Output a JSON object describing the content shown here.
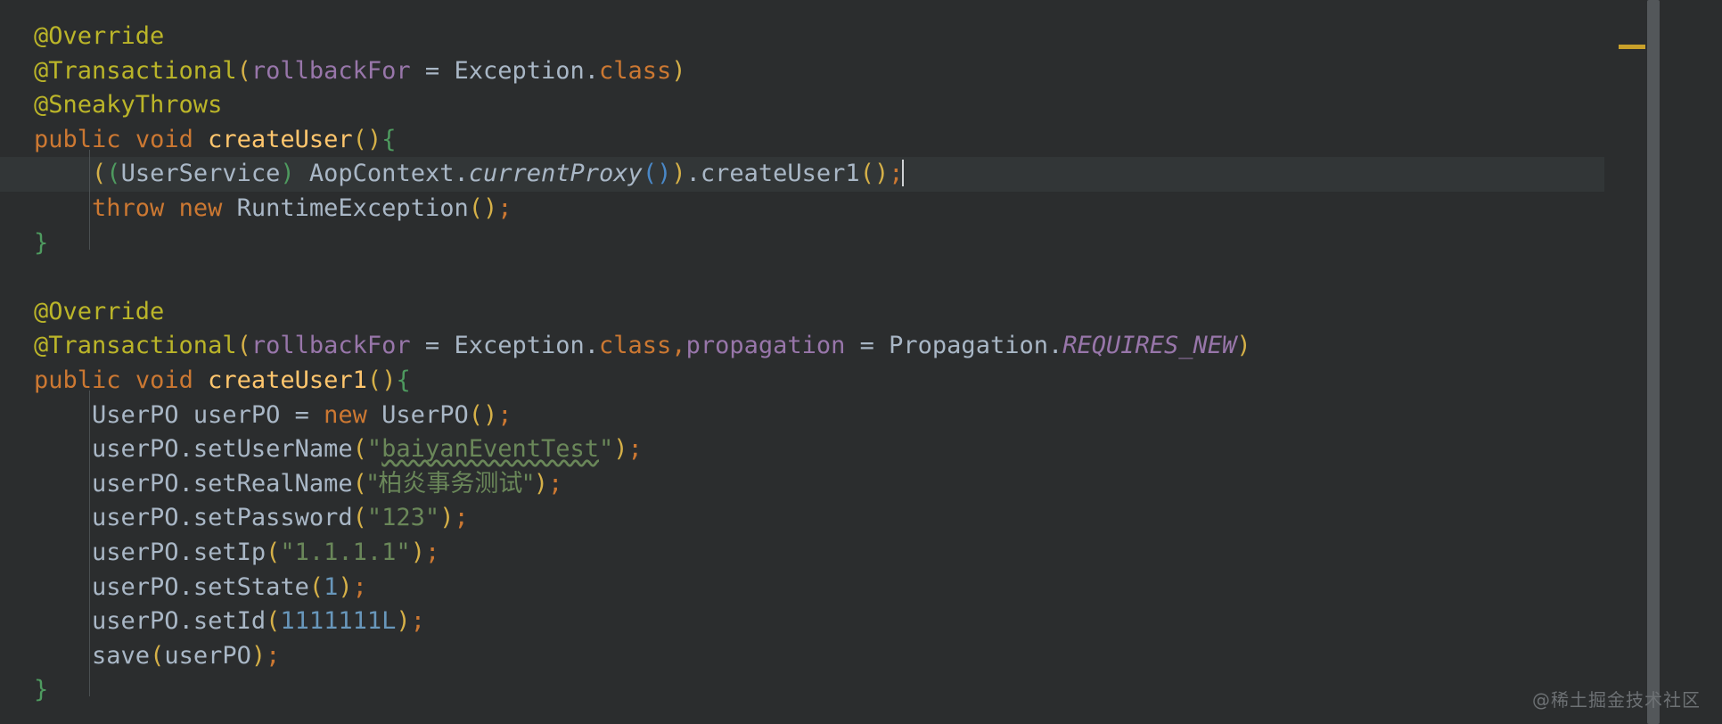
{
  "editor": {
    "theme": "darcula",
    "background_color": "#2b2d2e",
    "current_line_color": "#323637",
    "default_text_color": "#a9b7c6",
    "annotation_color": "#bbb529",
    "keyword_color": "#cc7832",
    "method_color": "#ffc66d",
    "string_color": "#6a8759",
    "number_color": "#6897bb",
    "constant_color": "#9876aa",
    "language": "Java"
  },
  "code": {
    "lines": [
      {
        "id": 1,
        "text": "@Override",
        "tokens": [
          {
            "t": "@Override",
            "c": "annot"
          }
        ]
      },
      {
        "id": 2,
        "text": "@Transactional(rollbackFor = Exception.class)",
        "tokens": [
          {
            "t": "@Transactional",
            "c": "annot"
          },
          {
            "t": "(",
            "c": "par-y"
          },
          {
            "t": "rollbackFor",
            "c": "field"
          },
          {
            "t": " = ",
            "c": "eq"
          },
          {
            "t": "Exception",
            "c": "ident"
          },
          {
            "t": ".",
            "c": "punct"
          },
          {
            "t": "class",
            "c": "kw"
          },
          {
            "t": ")",
            "c": "par-y"
          }
        ]
      },
      {
        "id": 3,
        "text": "@SneakyThrows",
        "tokens": [
          {
            "t": "@SneakyThrows",
            "c": "annot"
          }
        ]
      },
      {
        "id": 4,
        "text": "public void createUser(){",
        "tokens": [
          {
            "t": "public",
            "c": "kw"
          },
          {
            "t": " ",
            "c": "punct"
          },
          {
            "t": "void",
            "c": "kw"
          },
          {
            "t": " ",
            "c": "punct"
          },
          {
            "t": "createUser",
            "c": "method"
          },
          {
            "t": "(",
            "c": "par-y"
          },
          {
            "t": ")",
            "c": "par-y"
          },
          {
            "t": "{",
            "c": "par-g"
          }
        ]
      },
      {
        "id": 5,
        "current": true,
        "caret_at_end": true,
        "text": "    ((UserService) AopContext.currentProxy()).createUser1();",
        "tokens": [
          {
            "t": "    ",
            "c": "punct"
          },
          {
            "t": "(",
            "c": "par-y"
          },
          {
            "t": "(",
            "c": "par-g"
          },
          {
            "t": "UserService",
            "c": "ident"
          },
          {
            "t": ")",
            "c": "par-g"
          },
          {
            "t": " ",
            "c": "punct"
          },
          {
            "t": "AopContext",
            "c": "ident"
          },
          {
            "t": ".",
            "c": "punct"
          },
          {
            "t": "currentProxy",
            "c": "static-i"
          },
          {
            "t": "(",
            "c": "par-b"
          },
          {
            "t": ")",
            "c": "par-b"
          },
          {
            "t": ")",
            "c": "par-y"
          },
          {
            "t": ".",
            "c": "punct"
          },
          {
            "t": "createUser1",
            "c": "ident"
          },
          {
            "t": "(",
            "c": "par-y"
          },
          {
            "t": ")",
            "c": "par-y"
          },
          {
            "t": ";",
            "c": "semi"
          }
        ]
      },
      {
        "id": 6,
        "text": "    throw new RuntimeException();",
        "tokens": [
          {
            "t": "    ",
            "c": "punct"
          },
          {
            "t": "throw",
            "c": "kw"
          },
          {
            "t": " ",
            "c": "punct"
          },
          {
            "t": "new",
            "c": "kw"
          },
          {
            "t": " ",
            "c": "punct"
          },
          {
            "t": "RuntimeException",
            "c": "ident"
          },
          {
            "t": "(",
            "c": "par-y"
          },
          {
            "t": ")",
            "c": "par-y"
          },
          {
            "t": ";",
            "c": "semi"
          }
        ]
      },
      {
        "id": 7,
        "text": "}",
        "tokens": [
          {
            "t": "}",
            "c": "par-g"
          }
        ]
      },
      {
        "id": 8,
        "text": "",
        "tokens": []
      },
      {
        "id": 9,
        "text": "@Override",
        "tokens": [
          {
            "t": "@Override",
            "c": "annot"
          }
        ]
      },
      {
        "id": 10,
        "text": "@Transactional(rollbackFor = Exception.class,propagation = Propagation.REQUIRES_NEW)",
        "tokens": [
          {
            "t": "@Transactional",
            "c": "annot"
          },
          {
            "t": "(",
            "c": "par-y"
          },
          {
            "t": "rollbackFor",
            "c": "field"
          },
          {
            "t": " = ",
            "c": "eq"
          },
          {
            "t": "Exception",
            "c": "ident"
          },
          {
            "t": ".",
            "c": "punct"
          },
          {
            "t": "class",
            "c": "kw"
          },
          {
            "t": ",",
            "c": "semi"
          },
          {
            "t": "propagation",
            "c": "field"
          },
          {
            "t": " = ",
            "c": "eq"
          },
          {
            "t": "Propagation",
            "c": "ident"
          },
          {
            "t": ".",
            "c": "punct"
          },
          {
            "t": "REQUIRES_NEW",
            "c": "const-i"
          },
          {
            "t": ")",
            "c": "par-y"
          }
        ]
      },
      {
        "id": 11,
        "text": "public void createUser1(){",
        "tokens": [
          {
            "t": "public",
            "c": "kw"
          },
          {
            "t": " ",
            "c": "punct"
          },
          {
            "t": "void",
            "c": "kw"
          },
          {
            "t": " ",
            "c": "punct"
          },
          {
            "t": "createUser1",
            "c": "method"
          },
          {
            "t": "(",
            "c": "par-y"
          },
          {
            "t": ")",
            "c": "par-y"
          },
          {
            "t": "{",
            "c": "par-g"
          }
        ]
      },
      {
        "id": 12,
        "text": "    UserPO userPO = new UserPO();",
        "tokens": [
          {
            "t": "    ",
            "c": "punct"
          },
          {
            "t": "UserPO userPO ",
            "c": "ident"
          },
          {
            "t": "= ",
            "c": "eq"
          },
          {
            "t": "new",
            "c": "kw"
          },
          {
            "t": " ",
            "c": "punct"
          },
          {
            "t": "UserPO",
            "c": "ident"
          },
          {
            "t": "(",
            "c": "par-y"
          },
          {
            "t": ")",
            "c": "par-y"
          },
          {
            "t": ";",
            "c": "semi"
          }
        ]
      },
      {
        "id": 13,
        "text": "    userPO.setUserName(\"baiyanEventTest\");",
        "tokens": [
          {
            "t": "    ",
            "c": "punct"
          },
          {
            "t": "userPO.setUserName",
            "c": "ident"
          },
          {
            "t": "(",
            "c": "par-y"
          },
          {
            "t": "\"",
            "c": "str"
          },
          {
            "t": "baiyanEventTest",
            "c": "typo"
          },
          {
            "t": "\"",
            "c": "str"
          },
          {
            "t": ")",
            "c": "par-y"
          },
          {
            "t": ";",
            "c": "semi"
          }
        ]
      },
      {
        "id": 14,
        "text": "    userPO.setRealName(\"柏炎事务测试\");",
        "tokens": [
          {
            "t": "    ",
            "c": "punct"
          },
          {
            "t": "userPO.setRealName",
            "c": "ident"
          },
          {
            "t": "(",
            "c": "par-y"
          },
          {
            "t": "\"柏炎事务测试\"",
            "c": "str cn"
          },
          {
            "t": ")",
            "c": "par-y"
          },
          {
            "t": ";",
            "c": "semi"
          }
        ]
      },
      {
        "id": 15,
        "text": "    userPO.setPassword(\"123\");",
        "tokens": [
          {
            "t": "    ",
            "c": "punct"
          },
          {
            "t": "userPO.setPassword",
            "c": "ident"
          },
          {
            "t": "(",
            "c": "par-y"
          },
          {
            "t": "\"123\"",
            "c": "str"
          },
          {
            "t": ")",
            "c": "par-y"
          },
          {
            "t": ";",
            "c": "semi"
          }
        ]
      },
      {
        "id": 16,
        "text": "    userPO.setIp(\"1.1.1.1\");",
        "tokens": [
          {
            "t": "    ",
            "c": "punct"
          },
          {
            "t": "userPO.setIp",
            "c": "ident"
          },
          {
            "t": "(",
            "c": "par-y"
          },
          {
            "t": "\"1.1.1.1\"",
            "c": "str"
          },
          {
            "t": ")",
            "c": "par-y"
          },
          {
            "t": ";",
            "c": "semi"
          }
        ]
      },
      {
        "id": 17,
        "text": "    userPO.setState(1);",
        "tokens": [
          {
            "t": "    ",
            "c": "punct"
          },
          {
            "t": "userPO.setState",
            "c": "ident"
          },
          {
            "t": "(",
            "c": "par-y"
          },
          {
            "t": "1",
            "c": "num"
          },
          {
            "t": ")",
            "c": "par-y"
          },
          {
            "t": ";",
            "c": "semi"
          }
        ]
      },
      {
        "id": 18,
        "text": "    userPO.setId(1111111L);",
        "tokens": [
          {
            "t": "    ",
            "c": "punct"
          },
          {
            "t": "userPO.setId",
            "c": "ident"
          },
          {
            "t": "(",
            "c": "par-y"
          },
          {
            "t": "1111111L",
            "c": "num"
          },
          {
            "t": ")",
            "c": "par-y"
          },
          {
            "t": ";",
            "c": "semi"
          }
        ]
      },
      {
        "id": 19,
        "text": "    save(userPO);",
        "tokens": [
          {
            "t": "    ",
            "c": "punct"
          },
          {
            "t": "save",
            "c": "ident"
          },
          {
            "t": "(",
            "c": "par-y"
          },
          {
            "t": "userPO",
            "c": "ident"
          },
          {
            "t": ")",
            "c": "par-y"
          },
          {
            "t": ";",
            "c": "semi"
          }
        ]
      },
      {
        "id": 20,
        "text": "}",
        "tokens": [
          {
            "t": "}",
            "c": "par-g"
          }
        ]
      }
    ]
  },
  "scrollbar": {
    "thumb_color": "#53575a",
    "marker_color": "#c8a02a",
    "marker_label": "warning-marker"
  },
  "watermark": {
    "text": "@稀土掘金技术社区"
  }
}
